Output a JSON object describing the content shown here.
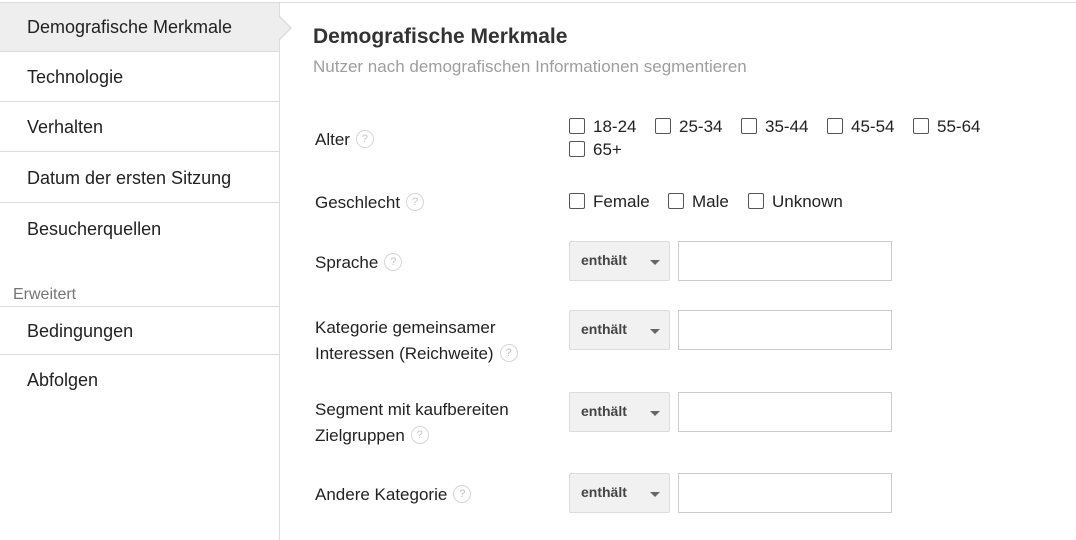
{
  "sidebar": {
    "items": [
      {
        "label": "Demografische Merkmale",
        "active": true
      },
      {
        "label": "Technologie"
      },
      {
        "label": "Verhalten"
      },
      {
        "label": "Datum der ersten Sitzung"
      },
      {
        "label": "Besucherquellen"
      }
    ],
    "advanced_label": "Erweitert",
    "advanced_items": [
      {
        "label": "Bedingungen"
      },
      {
        "label": "Abfolgen"
      }
    ]
  },
  "main": {
    "title": "Demografische Merkmale",
    "subtitle": "Nutzer nach demografischen Informationen segmentieren",
    "help_glyph": "?",
    "age": {
      "label": "Alter",
      "options": [
        "18-24",
        "25-34",
        "35-44",
        "45-54",
        "55-64",
        "65+"
      ]
    },
    "gender": {
      "label": "Geschlecht",
      "options": [
        "Female",
        "Male",
        "Unknown"
      ]
    },
    "language": {
      "label": "Sprache",
      "operator": "enthält",
      "value": ""
    },
    "affinity": {
      "label_line1": "Kategorie gemeinsamer",
      "label_line2": "Interessen (Reichweite)",
      "operator": "enthält",
      "value": ""
    },
    "in_market": {
      "label_line1": "Segment mit kaufbereiten",
      "label_line2": "Zielgruppen",
      "operator": "enthält",
      "value": ""
    },
    "other": {
      "label": "Andere Kategorie",
      "operator": "enthält",
      "value": ""
    }
  },
  "colors": {
    "active_bg": "#eeeeee",
    "border": "#dcdcdc",
    "subtitle": "#9e9e9e",
    "dropdown_bg": "#f1f1f1"
  },
  "icons": {
    "help": "help-icon",
    "caret": "caret-down-icon",
    "active_pointer": "pointer-arrow-icon"
  }
}
